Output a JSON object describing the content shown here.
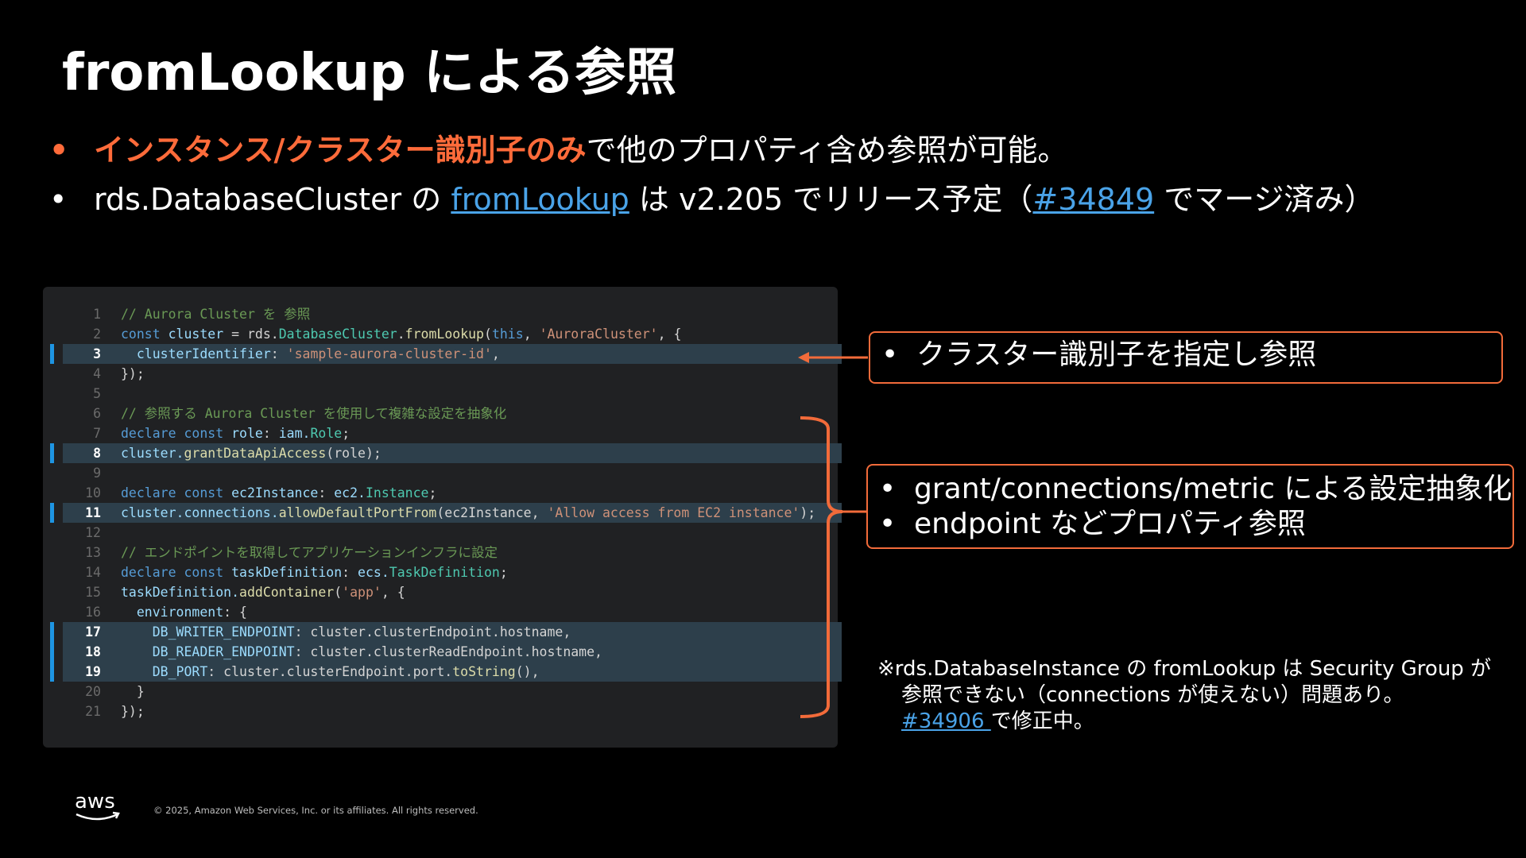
{
  "slide": {
    "title": "fromLookup による参照"
  },
  "bullets": [
    {
      "dot": "•",
      "emphasis": "インスタンス/クラスター識別子のみ",
      "rest": "で他のプロパティ含め参照が可能。"
    },
    {
      "dot": "•",
      "part1": "rds.DatabaseCluster の ",
      "link1": "fromLookup",
      "part2": " は v2.205 でリリース予定（",
      "link2": "#34849",
      "part3": " でマージ済み）"
    }
  ],
  "code": {
    "lines": [
      {
        "n": "1"
      },
      {
        "n": "2"
      },
      {
        "n": "3"
      },
      {
        "n": "4"
      },
      {
        "n": "5"
      },
      {
        "n": "6"
      },
      {
        "n": "7"
      },
      {
        "n": "8"
      },
      {
        "n": "9"
      },
      {
        "n": "10"
      },
      {
        "n": "11"
      },
      {
        "n": "12"
      },
      {
        "n": "13"
      },
      {
        "n": "14"
      },
      {
        "n": "15"
      },
      {
        "n": "16"
      },
      {
        "n": "17"
      },
      {
        "n": "18"
      },
      {
        "n": "19"
      },
      {
        "n": "20"
      },
      {
        "n": "21"
      }
    ],
    "t": {
      "l1_comment": "// Aurora Cluster を 参照",
      "l2_const": "const",
      "l2_cluster": "cluster",
      "l2_eq": " = rds.",
      "l2_class": "DatabaseCluster",
      "l2_dot": ".",
      "l2_fn": "fromLookup",
      "l2_open": "(",
      "l2_this": "this",
      "l2_comma": ", ",
      "l2_str": "'AuroraCluster'",
      "l2_end": ", {",
      "l3_prop": "clusterIdentifier",
      "l3_colon": ": ",
      "l3_str": "'sample-aurora-cluster-id'",
      "l3_end": ",",
      "l4": "});",
      "l6_comment": "// 参照する Aurora Cluster を使用して複雑な設定を抽象化",
      "l7_declare": "declare const",
      "l7_var": "role",
      "l7_colon": ": ",
      "l7_ns": "iam.",
      "l7_type": "Role",
      "l7_end": ";",
      "l8_obj": "cluster.",
      "l8_fn": "grantDataApiAccess",
      "l8_rest": "(role);",
      "l10_declare": "declare const",
      "l10_var": "ec2Instance",
      "l10_colon": ": ",
      "l10_ns": "ec2.",
      "l10_type": "Instance",
      "l10_end": ";",
      "l11_obj": "cluster.connections.",
      "l11_fn": "allowDefaultPortFrom",
      "l11_open": "(ec2Instance, ",
      "l11_str": "'Allow access from EC2 instance'",
      "l11_end": ");",
      "l13_comment": "// エンドポイントを取得してアプリケーションインフラに設定",
      "l14_declare": "declare const",
      "l14_var": "taskDefinition",
      "l14_colon": ": ",
      "l14_ns": "ecs.",
      "l14_type": "TaskDefinition",
      "l14_end": ";",
      "l15_obj": "taskDefinition.",
      "l15_fn": "addContainer",
      "l15_open": "(",
      "l15_str": "'app'",
      "l15_end": ", {",
      "l16_prop": "environment",
      "l16_end": ": {",
      "l17_prop": "DB_WRITER_ENDPOINT",
      "l17_rest": ": cluster.clusterEndpoint.hostname,",
      "l18_prop": "DB_READER_ENDPOINT",
      "l18_rest": ": cluster.clusterReadEndpoint.hostname,",
      "l19_prop": "DB_PORT",
      "l19_rest": ": cluster.clusterEndpoint.port.",
      "l19_fn": "toString",
      "l19_end": "(),",
      "l20": "}",
      "l21": "});"
    }
  },
  "callouts": {
    "identifier": {
      "dot": "•",
      "text": "クラスター識別子を指定し参照"
    },
    "abstraction": [
      {
        "dot": "•",
        "text": "grant/connections/metric による設定抽象化"
      },
      {
        "dot": "•",
        "text": "endpoint などプロパティ参照"
      }
    ]
  },
  "note": {
    "line1": "※rds.DatabaseInstance の fromLookup は Security Group が",
    "line2": "参照できない（connections が使えない）問題あり。",
    "link": "#34906 ",
    "line3_rest": "で修正中。"
  },
  "footer": {
    "logo_text": "aws",
    "copyright": "© 2025, Amazon Web Services, Inc. or its affiliates. All rights reserved."
  },
  "colors": {
    "accent": "#ff6b3a",
    "link": "#4aa3e8",
    "callout_border": "#f26b3a",
    "highlight_marker": "#1e95e2"
  }
}
